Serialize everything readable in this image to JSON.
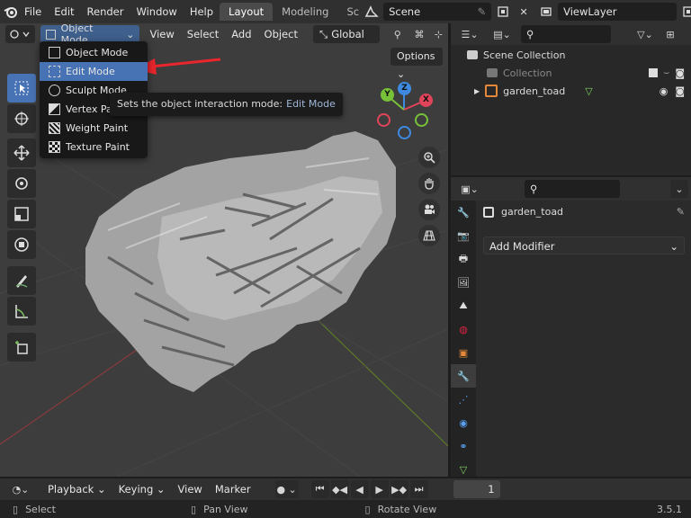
{
  "topbar": {
    "menus": [
      "File",
      "Edit",
      "Render",
      "Window",
      "Help"
    ],
    "workspaces": [
      "Layout",
      "Modeling",
      "Sc"
    ],
    "active_workspace": "Layout",
    "scene": "Scene",
    "view_layer": "ViewLayer"
  },
  "viewport": {
    "mode_label": "Object Mode",
    "menus": [
      "View",
      "Select",
      "Add",
      "Object"
    ],
    "orientation": "Global",
    "options_label": "Options",
    "gizmo": {
      "x": "X",
      "y": "Y",
      "z": "Z"
    }
  },
  "mode_menu": {
    "items": [
      "Object Mode",
      "Edit Mode",
      "Sculpt Mode",
      "Vertex Paint",
      "Weight Paint",
      "Texture Paint"
    ],
    "highlighted": "Edit Mode"
  },
  "tooltip": {
    "text": "Sets the object interaction mode:",
    "value": "Edit Mode"
  },
  "outliner": {
    "scene_collection": "Scene Collection",
    "collection": "Collection",
    "object": "garden_toad"
  },
  "properties": {
    "object_name": "garden_toad",
    "add_modifier": "Add Modifier"
  },
  "timeline": {
    "menus": [
      "Playback",
      "Keying",
      "View",
      "Marker"
    ],
    "frame": "1"
  },
  "statusbar": {
    "select": "Select",
    "pan": "Pan View",
    "rotate": "Rotate View",
    "version": "3.5.1"
  },
  "colors": {
    "accent": "#4772b3",
    "x_axis": "#e0445a",
    "y_axis": "#78c23a",
    "z_axis": "#3d8ae0",
    "arrow": "#e8262c"
  }
}
